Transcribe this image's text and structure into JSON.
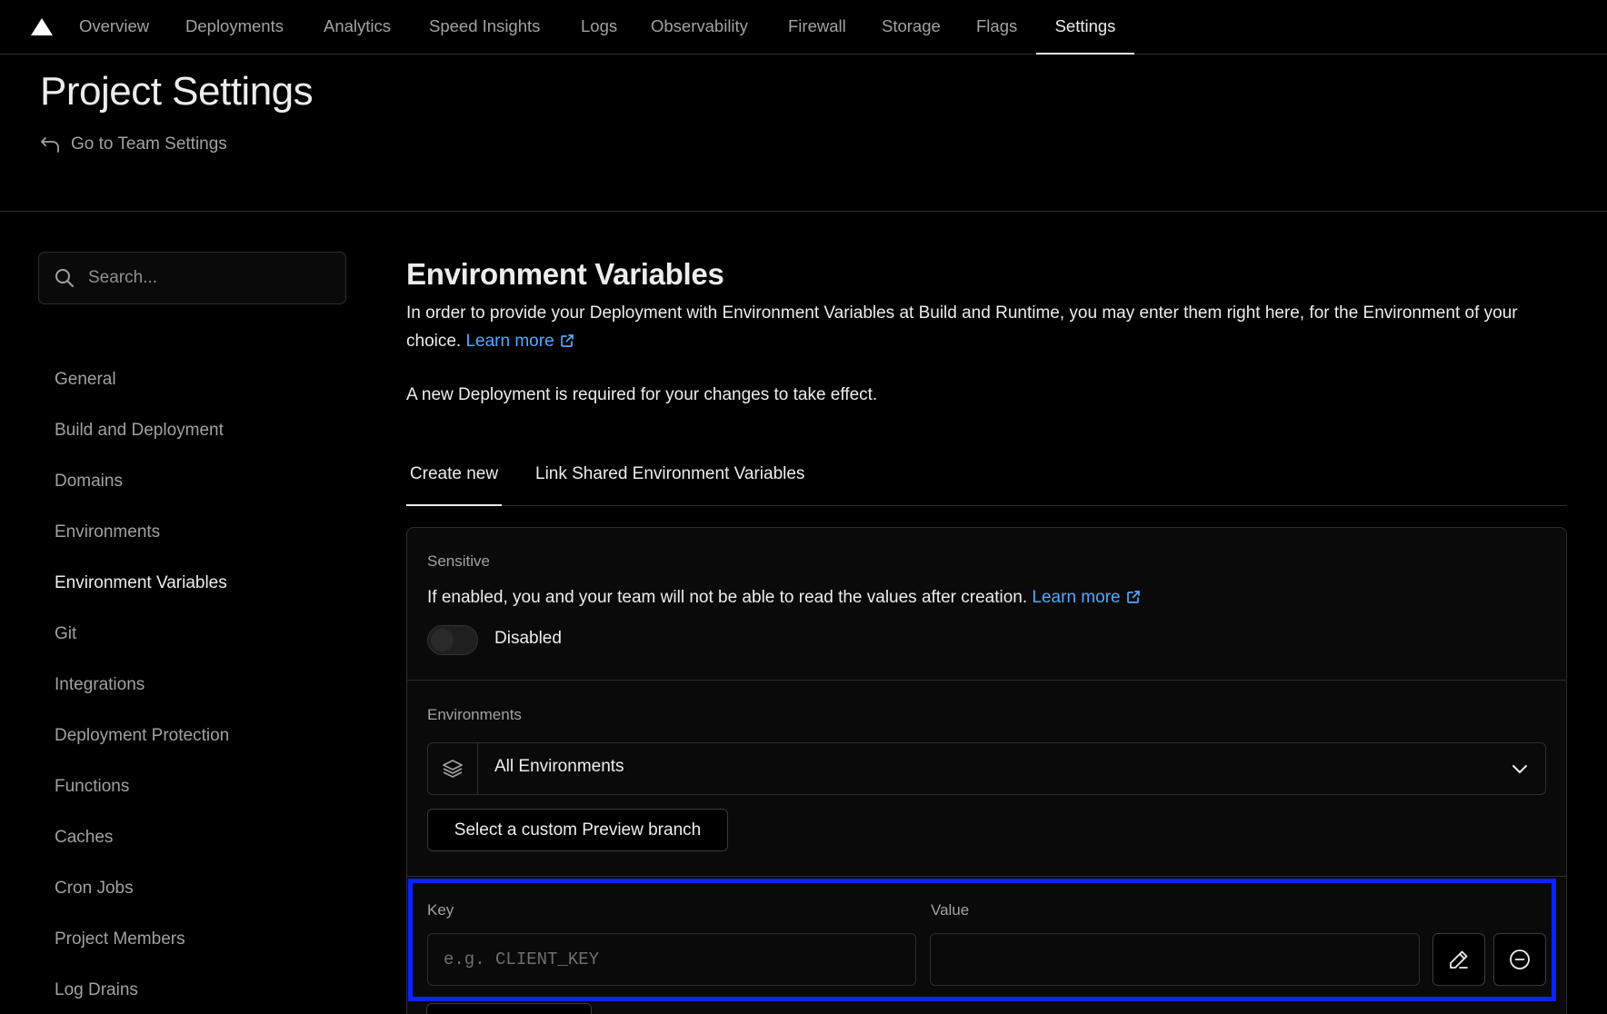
{
  "topnav": {
    "tabs": [
      "Overview",
      "Deployments",
      "Analytics",
      "Speed Insights",
      "Logs",
      "Observability",
      "Firewall",
      "Storage",
      "Flags",
      "Settings"
    ],
    "active": "Settings"
  },
  "header": {
    "title": "Project Settings",
    "back_link": "Go to Team Settings"
  },
  "sidebar": {
    "search_placeholder": "Search...",
    "items": [
      "General",
      "Build and Deployment",
      "Domains",
      "Environments",
      "Environment Variables",
      "Git",
      "Integrations",
      "Deployment Protection",
      "Functions",
      "Caches",
      "Cron Jobs",
      "Project Members",
      "Log Drains"
    ],
    "active": "Environment Variables"
  },
  "main": {
    "title": "Environment Variables",
    "description": "In order to provide your Deployment with Environment Variables at Build and Runtime, you may enter them right here, for the Environment of your choice.",
    "learn_more": "Learn more",
    "note": "A new Deployment is required for your changes to take effect.",
    "tabs": [
      "Create new",
      "Link Shared Environment Variables"
    ],
    "sensitive": {
      "label": "Sensitive",
      "text": "If enabled, you and your team will not be able to read the values after creation.",
      "learn_more": "Learn more",
      "toggle_label": "Disabled"
    },
    "environments": {
      "label": "Environments",
      "value": "All Environments",
      "custom_branch_button": "Select a custom Preview branch"
    },
    "kv": {
      "key_label": "Key",
      "value_label": "Value",
      "key_placeholder": "e.g. CLIENT_KEY",
      "value_placeholder": ""
    }
  },
  "colors": {
    "link": "#52a8ff",
    "highlight": "#0a23ff",
    "background": "#000000"
  }
}
